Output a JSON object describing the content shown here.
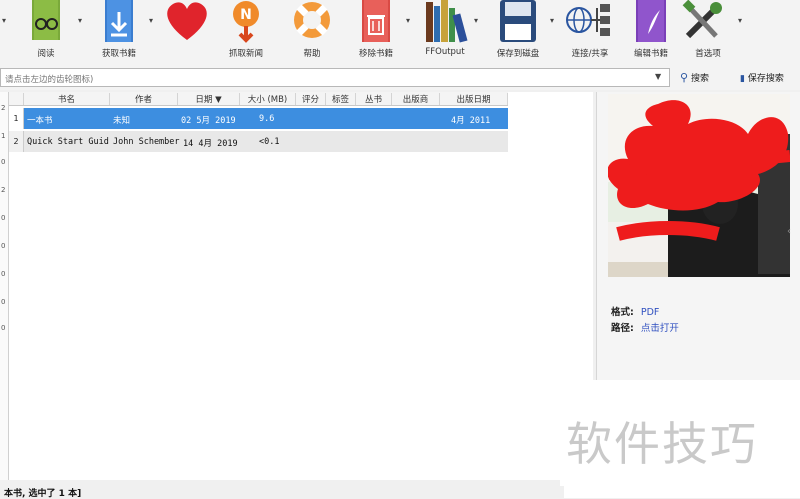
{
  "toolbar": {
    "items": [
      {
        "label": "阅读",
        "icon": "read-glasses-book-icon"
      },
      {
        "label": "获取书籍",
        "icon": "download-book-icon"
      },
      {
        "label": "",
        "icon": "heart-icon"
      },
      {
        "label": "抓取新闻",
        "icon": "news-icon"
      },
      {
        "label": "帮助",
        "icon": "lifebuoy-icon"
      },
      {
        "label": "移除书籍",
        "icon": "trash-book-icon"
      },
      {
        "label": "FFOutput",
        "icon": "library-books-icon"
      },
      {
        "label": "保存到磁盘",
        "icon": "floppy-disk-icon"
      },
      {
        "label": "连接/共享",
        "icon": "globe-share-icon"
      },
      {
        "label": "编辑书籍",
        "icon": "edit-book-icon"
      },
      {
        "label": "首选项",
        "icon": "tools-icon"
      }
    ]
  },
  "search": {
    "placeholder": "请点击左边的齿轮图标)",
    "search_label": "搜索",
    "save_label": "保存搜索"
  },
  "table": {
    "columns": [
      "书名",
      "作者",
      "日期",
      "大小 (MB)",
      "评分",
      "标签",
      "丛书",
      "出版商",
      "出版日期"
    ],
    "rows": [
      {
        "num": "1",
        "title": "一本书",
        "author": "未知",
        "date": "02 5月 2019",
        "size": "9.6",
        "pubdate": "4月 2011"
      },
      {
        "num": "2",
        "title": "Quick Start Guide",
        "author": "John Schember",
        "date": "14 4月 2019",
        "size": "<0.1",
        "pubdate": ""
      }
    ]
  },
  "details": {
    "format_label": "格式:",
    "format_value": "PDF",
    "path_label": "路径:",
    "path_value": "点击打开"
  },
  "status": {
    "text": "本书, 选中了 1 本]"
  },
  "watermark": "软件技巧",
  "colors": {
    "selection": "#3d8ee0",
    "link": "#3050c0"
  }
}
